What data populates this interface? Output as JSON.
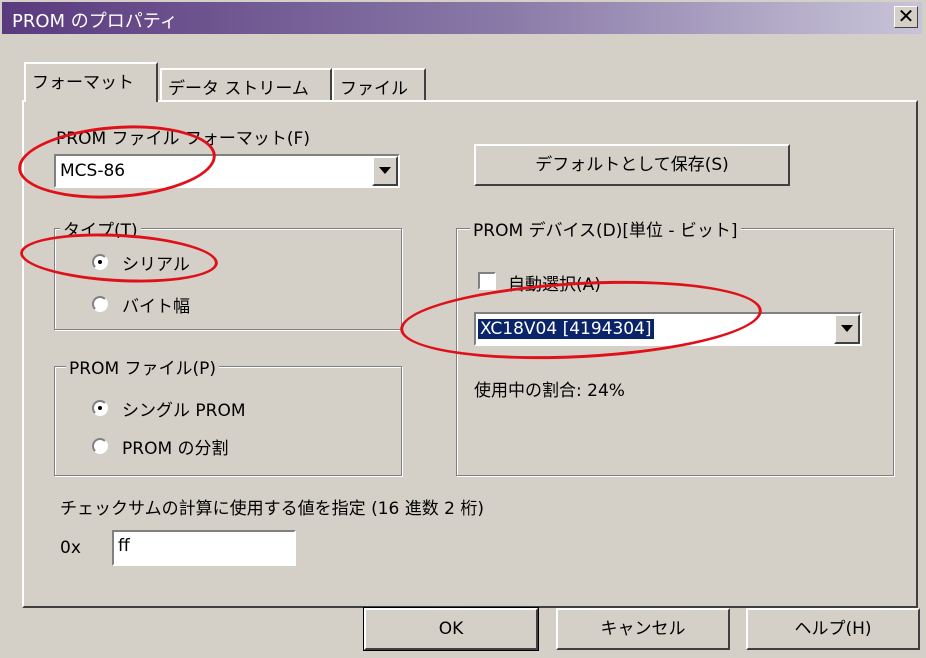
{
  "window": {
    "title": "PROM のプロパティ",
    "close_label": "✕"
  },
  "tabs": [
    {
      "label": "フォーマット"
    },
    {
      "label": "データ ストリーム"
    },
    {
      "label": "ファイル"
    }
  ],
  "format": {
    "label": "PROM ファイル フォーマット(F)",
    "value": "MCS-86"
  },
  "save_default_label": "デフォルトとして保存(S)",
  "type_group": {
    "legend": "タイプ(T)",
    "options": [
      {
        "label": "シリアル",
        "selected": true
      },
      {
        "label": "バイト幅",
        "selected": false
      }
    ]
  },
  "prom_file_group": {
    "legend": "PROM ファイル(P)",
    "options": [
      {
        "label": "シングル PROM",
        "selected": true
      },
      {
        "label": "PROM の分割",
        "selected": false
      }
    ]
  },
  "device_group": {
    "legend": "PROM デバイス(D)[単位 - ビット]",
    "auto_select_label": "自動選択(A)",
    "device_value": "XC18V04  [4194304]",
    "usage_text": "使用中の割合: 24%"
  },
  "checksum": {
    "label": "チェックサムの計算に使用する値を指定 (16 進数 2 桁)",
    "prefix": "0x",
    "value": "ff"
  },
  "buttons": {
    "ok": "OK",
    "cancel": "キャンセル",
    "help": "ヘルプ(H)"
  },
  "colors": {
    "annotation": "#e0101a",
    "face": "#d4d0c8",
    "selection": "#0a246a"
  }
}
